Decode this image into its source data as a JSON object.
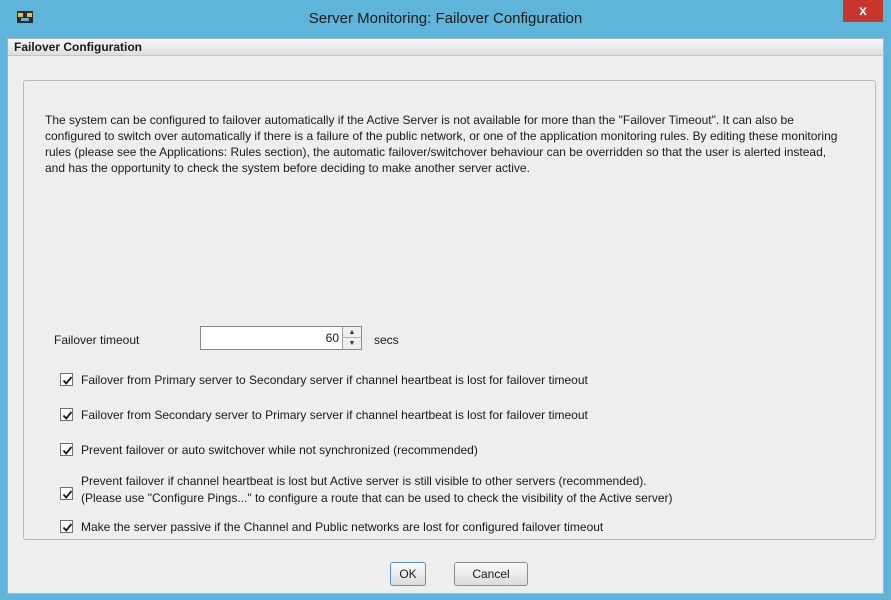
{
  "window": {
    "title": "Server Monitoring: Failover Configuration",
    "close_label": "x"
  },
  "section": {
    "header": "Failover Configuration"
  },
  "description": "The system can be configured to failover automatically if the Active Server is not available for more than the \"Failover Timeout\". It can also be configured to switch over automatically if there is a failure of the public network, or one of the application monitoring rules. By editing these monitoring rules (please see the Applications: Rules section), the automatic failover/switchover behaviour can be overridden so that the user is alerted instead, and has the opportunity to check the system before deciding to make another server active.",
  "timeout": {
    "label": "Failover timeout",
    "value": "60",
    "unit": "secs"
  },
  "options": [
    {
      "line1": "Failover from Primary server to Secondary server if channel heartbeat is lost for failover timeout",
      "line2": "",
      "checked": true
    },
    {
      "line1": "Failover from Secondary server to Primary server if channel heartbeat is lost for failover timeout",
      "line2": "",
      "checked": true
    },
    {
      "line1": "Prevent failover or auto switchover while not synchronized (recommended)",
      "line2": "",
      "checked": true
    },
    {
      "line1": "Prevent failover if channel heartbeat is lost but Active server is still visible to other servers (recommended).",
      "line2": "(Please use \"Configure Pings...\" to configure a route that can be used to check the visibility of the Active server)",
      "checked": true
    },
    {
      "line1": "Make the server passive if the Channel and Public networks are lost for configured failover timeout",
      "line2": "",
      "checked": true
    }
  ],
  "buttons": {
    "ok": "OK",
    "cancel": "Cancel"
  },
  "colors": {
    "titlebar": "#5fb4d9",
    "close": "#c6362c",
    "checkmark": "#1a1a1a"
  },
  "icons": {
    "app": "app-window-icon",
    "close": "close-icon",
    "spin_up": "chevron-up-icon",
    "spin_down": "chevron-down-icon",
    "check": "checkmark-icon"
  }
}
